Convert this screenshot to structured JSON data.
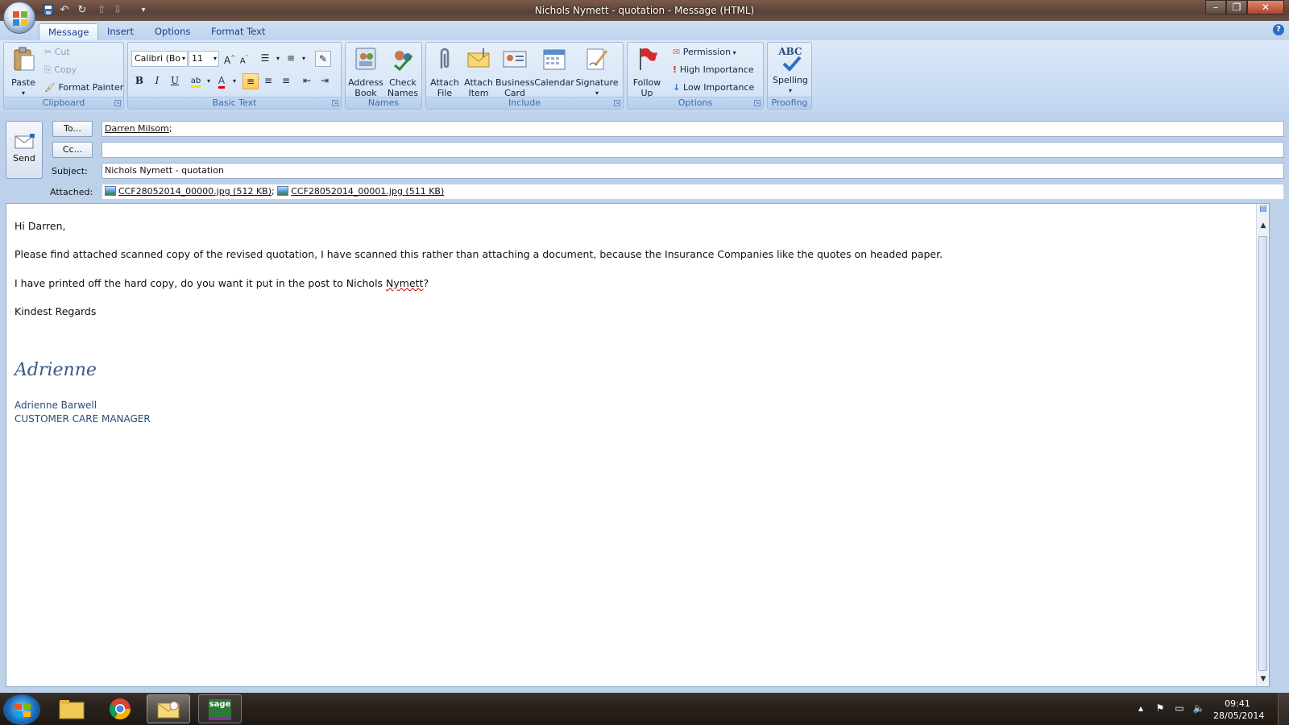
{
  "window": {
    "title": "Nichols Nymett - quotation - Message (HTML)"
  },
  "quick_access": {
    "icons": [
      "save-icon",
      "undo-icon",
      "redo-icon",
      "prev-icon",
      "next-icon",
      "customize-icon"
    ]
  },
  "tabs": [
    {
      "label": "Message",
      "active": true
    },
    {
      "label": "Insert",
      "active": false
    },
    {
      "label": "Options",
      "active": false
    },
    {
      "label": "Format Text",
      "active": false
    }
  ],
  "ribbon": {
    "clipboard": {
      "group_label": "Clipboard",
      "paste": "Paste",
      "cut": "Cut",
      "copy": "Copy",
      "format_painter": "Format Painter"
    },
    "basic_text": {
      "group_label": "Basic Text",
      "font": "Calibri (Bo",
      "size": "11",
      "bold": "B",
      "italic": "I",
      "underline": "U"
    },
    "names": {
      "group_label": "Names",
      "address_book": "Address Book",
      "check_names": "Check Names"
    },
    "include": {
      "group_label": "Include",
      "attach_file": "Attach File",
      "attach_item": "Attach Item",
      "business_card": "Business Card",
      "calendar": "Calendar",
      "signature": "Signature"
    },
    "options": {
      "group_label": "Options",
      "follow_up": "Follow Up",
      "permission": "Permission",
      "high_importance": "High Importance",
      "low_importance": "Low Importance"
    },
    "proofing": {
      "group_label": "Proofing",
      "spelling": "Spelling",
      "spelling_icon_text": "ABC"
    }
  },
  "compose": {
    "send_label": "Send",
    "to_button": "To...",
    "cc_button": "Cc...",
    "to_value": "Darren Milsom",
    "to_sep": ";",
    "cc_value": "",
    "subject_label": "Subject:",
    "subject_value": "Nichols Nymett - quotation",
    "attached_label": "Attached:",
    "attachments": [
      {
        "name": "CCF28052014_00000.jpg (512 KB)",
        "sep": ";"
      },
      {
        "name": "CCF28052014_00001.jpg (511 KB)",
        "sep": ""
      }
    ]
  },
  "message": {
    "greeting": "Hi Darren,",
    "para1": "Please find attached scanned copy of the revised quotation, I have scanned this rather than attaching a document, because the Insurance Companies like the quotes on headed paper.",
    "para2_before": "I have printed off the hard copy, do you want it put in the post to Nichols ",
    "para2_misspelled": "Nymett",
    "para2_after": "?",
    "closing": "Kindest Regards",
    "signature_script": "Adrienne",
    "signature_name": "Adrienne Barwell",
    "signature_title": "CUSTOMER CARE MANAGER"
  },
  "taskbar": {
    "apps": [
      "windows-explorer",
      "chrome",
      "outlook",
      "sage"
    ],
    "sage_label": "sage",
    "time": "09:41",
    "date": "28/05/2014"
  }
}
